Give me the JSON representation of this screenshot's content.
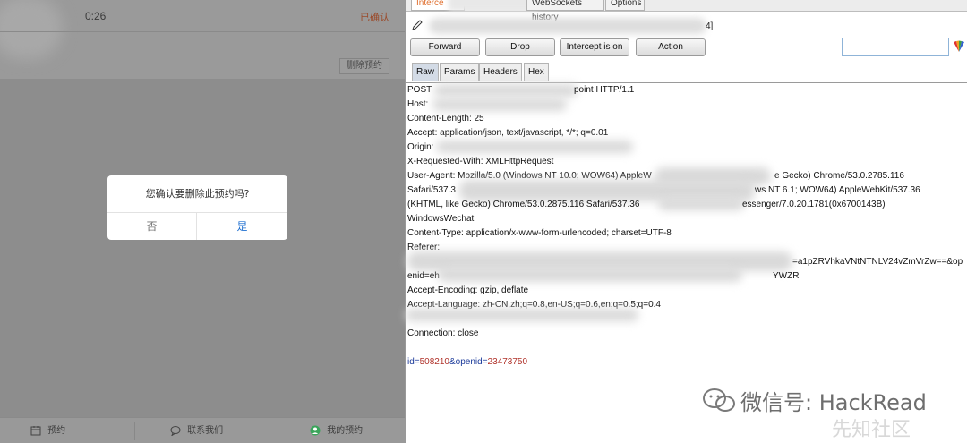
{
  "mobile": {
    "order": {
      "time": "0:26",
      "status": "已确认",
      "cancel_button": "删除预约"
    },
    "dialog": {
      "message": "您确认要删除此预约吗?",
      "no_label": "否",
      "yes_label": "是"
    },
    "bottom_nav": [
      {
        "label": "预约",
        "icon": "calendar-icon"
      },
      {
        "label": "联系我们",
        "icon": "chat-icon"
      },
      {
        "label": "我的预约",
        "icon": "user-icon"
      }
    ]
  },
  "burp": {
    "tabs": {
      "intercept": "Interce",
      "websockets": "WebSockets history",
      "options": "Options"
    },
    "request_line_suffix": "4]",
    "buttons": {
      "forward": "Forward",
      "drop": "Drop",
      "intercept": "Intercept is on",
      "action": "Action"
    },
    "search_value": "",
    "subtabs": [
      "Raw",
      "Params",
      "Headers",
      "Hex"
    ],
    "request": {
      "method": "POST",
      "request_line_tail": "point HTTP/1.1",
      "host_label": "Host:",
      "content_length": "Content-Length: 25",
      "accept": "Accept: application/json, text/javascript, */*; q=0.01",
      "origin_label": "Origin:",
      "x_requested_with": "X-Requested-With: XMLHttpRequest",
      "user_agent_start": "User-Agent: Mozilla/5.0 (Windows NT 10.0; WOW64) AppleW",
      "user_agent_mid": "e Gecko) Chrome/53.0.2785.116",
      "safari_start": "Safari/537.3",
      "safari_mid": "ws NT 6.1; WOW64) AppleWebKit/537.36",
      "khtml_start": "(KHTML, like Gecko) Chrome/53.0.2875.116 Safari/537.36",
      "khtml_end": "essenger/7.0.20.1781(0x6700143B)",
      "windows_wechat": "WindowsWechat",
      "content_type": "Content-Type: application/x-www-form-urlencoded; charset=UTF-8",
      "referer_label": "Referer:",
      "referer_end": "=a1pZRVhkaVNtNTNLV24vZmVrZw==&op",
      "enid_start": "enid=eh",
      "enid_end": "YWZR",
      "accept_encoding": "Accept-Encoding: gzip, deflate",
      "accept_language": "Accept-Language: zh-CN,zh;q=0.8,en-US;q=0.6,en;q=0.5;q=0.4",
      "connection": "Connection: close",
      "body_id_key": "id=",
      "body_id_val": "508210",
      "body_sep": "&openid=",
      "body_openid_val": "23473750"
    }
  },
  "watermark": {
    "text": "微信号: HackRead",
    "site": "先知社区"
  }
}
